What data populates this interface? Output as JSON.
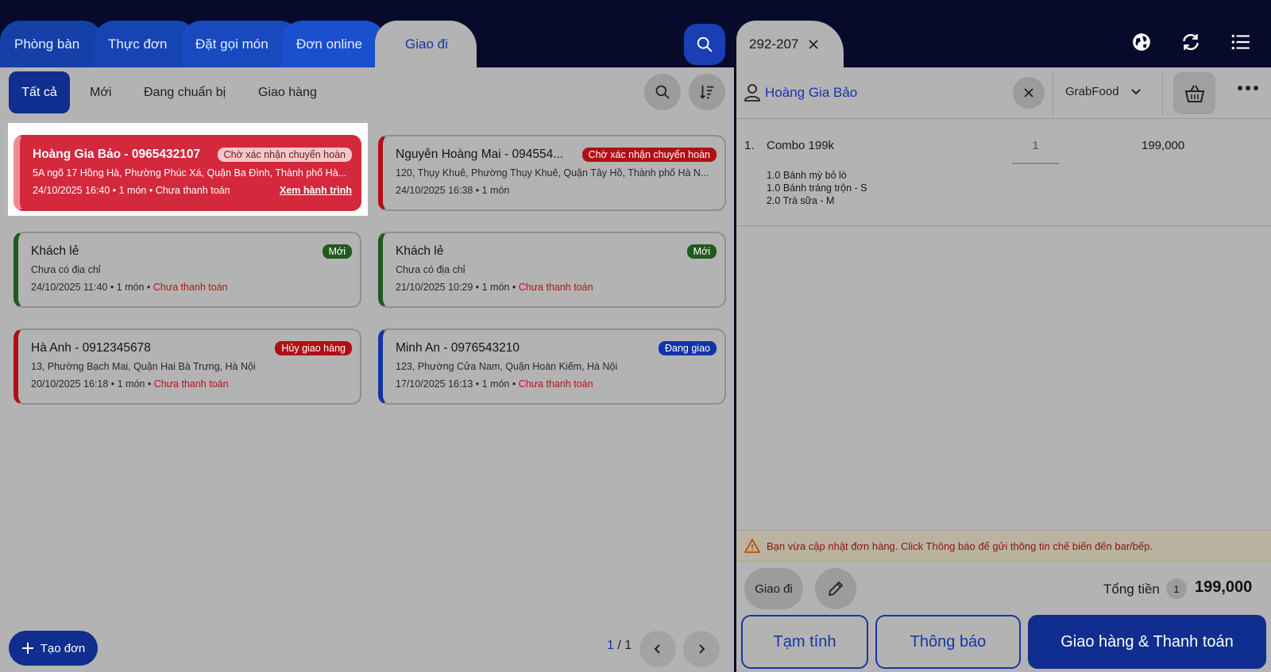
{
  "tabs": [
    {
      "label": "Phòng bàn"
    },
    {
      "label": "Thực đơn"
    },
    {
      "label": "Đặt gọi món"
    },
    {
      "label": "Đơn online"
    },
    {
      "label": "Giao đi"
    }
  ],
  "filters": [
    {
      "label": "Tất cả"
    },
    {
      "label": "Mới"
    },
    {
      "label": "Đang chuẩn bị"
    },
    {
      "label": "Giao hàng"
    }
  ],
  "orders": [
    {
      "name": "Hoàng Gia Bảo - 0965432107",
      "status": "Chờ xác nhận chuyển hoàn",
      "address": "5A ngõ 17 Hồng Hà, Phường Phúc Xá, Quận Ba Đình, Thành phố Hà...",
      "meta": "24/10/2025 16:40 • 1 món • Chưa thanh toán",
      "link": "Xem hành trình"
    },
    {
      "name": "Nguyễn Hoàng Mai - 094554...",
      "status": "Chờ xác nhận chuyển hoàn",
      "address": "120, Thụy Khuê, Phường Thụy Khuê, Quận Tây Hồ, Thành phố Hà N...",
      "meta": "24/10/2025 16:38 • 1 món"
    },
    {
      "name": "Khách lẻ",
      "status": "Mới",
      "address": "Chưa có địa chỉ",
      "meta": "24/10/2025 11:40 • 1 món • ",
      "payment": "Chưa thanh toán"
    },
    {
      "name": "Khách lẻ",
      "status": "Mới",
      "address": "Chưa có địa chỉ",
      "meta": "21/10/2025 10:29 • 1 món • ",
      "payment": "Chưa thanh toán"
    },
    {
      "name": "Hà Anh - 0912345678",
      "status": "Hủy giao hàng",
      "address": "13, Phường Bạch Mai, Quận Hai Bà Trưng, Hà Nội",
      "meta": "20/10/2025 16:18 • 1 món • ",
      "payment": "Chưa thanh toán"
    },
    {
      "name": "Minh An - 0976543210",
      "status": "Đang giao",
      "address": "123, Phường Cửa Nam, Quận Hoàn Kiếm, Hà Nội",
      "meta": "17/10/2025 16:13 • 1 món • ",
      "payment": "Chưa thanh toán"
    }
  ],
  "create_button": "Tạo đơn",
  "pager": {
    "current": "1",
    "total": " / 1"
  },
  "order_panel": {
    "tab_label": "292-207",
    "customer": "Hoàng Gia Bảo",
    "channel": "GrabFood",
    "item": {
      "index": "1.",
      "name": "Combo 199k",
      "qty": "1",
      "price": "199,000",
      "details": [
        "1.0 Bánh mỳ bỏ lò",
        "1.0 Bánh tráng trộn - S",
        "2.0 Trà sữa - M"
      ]
    },
    "warning": "Bạn vừa cập nhật đơn hàng. Click Thông báo để gửi thông tin chế biến đến bar/bếp.",
    "mode": "Giao đi",
    "total_label": "Tổng tiền",
    "total_count": "1",
    "total_value": "199,000",
    "buttons": {
      "temp": "Tạm tính",
      "notify": "Thông báo",
      "deliver_pay": "Giao hàng & Thanh toán"
    }
  },
  "colors": {
    "brand": "#0f2e8f",
    "danger": "#d4283c",
    "background": "#070a2a",
    "panel": "#b3b3b3"
  }
}
